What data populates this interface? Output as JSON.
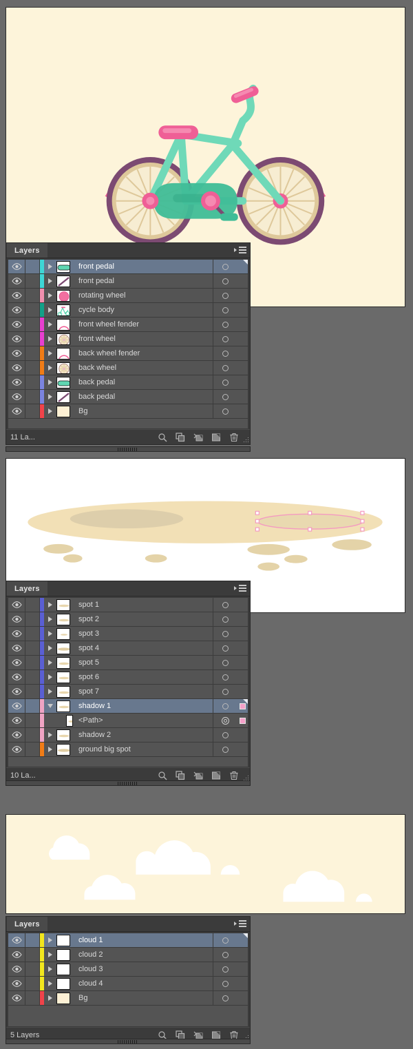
{
  "app": {
    "panel_title": "Layers",
    "menu_icon": "panel-flyout-menu-icon"
  },
  "colors": {
    "panel_bg": "#3b3b3b",
    "row_bg": "#545454",
    "row_selected": "#68788e",
    "canvas_cream": "#fdf4da",
    "canvas_white": "#ffffff",
    "workspace": "#6a6a6a",
    "selection_pink": "#f49ac1",
    "swatch_pink": "#f4a0c8"
  },
  "footer_icons": [
    {
      "name": "locate-object-icon",
      "label": "Locate Object"
    },
    {
      "name": "duplicate-layer-icon",
      "label": "Make/Release Clipping Mask"
    },
    {
      "name": "create-sublayer-icon",
      "label": "Create New Sublayer"
    },
    {
      "name": "new-layer-icon",
      "label": "Create New Layer"
    },
    {
      "name": "delete-layer-icon",
      "label": "Delete Selection"
    }
  ],
  "panels": [
    {
      "id": "bike",
      "title": "Layers",
      "count_label": "11 La...",
      "rows": [
        {
          "name": "front pedal",
          "color": "#3ed6d6",
          "selected": true,
          "expanded": false,
          "thumb": "pedal-green",
          "indent": 0,
          "target": "single",
          "swatch": null
        },
        {
          "name": "front pedal",
          "color": "#3ed6d6",
          "selected": false,
          "expanded": false,
          "thumb": "crank-diag",
          "indent": 0,
          "target": "single",
          "swatch": null
        },
        {
          "name": "rotating wheel",
          "color": "#f08fae",
          "selected": false,
          "expanded": false,
          "thumb": "hub-pink",
          "indent": 0,
          "target": "single",
          "swatch": null
        },
        {
          "name": "cycle body",
          "color": "#12a188",
          "selected": false,
          "expanded": false,
          "thumb": "frame-mini",
          "indent": 0,
          "target": "single",
          "swatch": null
        },
        {
          "name": "front wheel fender",
          "color": "#e83fd0",
          "selected": false,
          "expanded": false,
          "thumb": "fender-arc",
          "indent": 0,
          "target": "single",
          "swatch": null
        },
        {
          "name": "front wheel",
          "color": "#e83fd0",
          "selected": false,
          "expanded": false,
          "thumb": "wheel-spokes",
          "indent": 0,
          "target": "single",
          "swatch": null
        },
        {
          "name": "back wheel fender",
          "color": "#f07c16",
          "selected": false,
          "expanded": false,
          "thumb": "fender-arc",
          "indent": 0,
          "target": "single",
          "swatch": null
        },
        {
          "name": "back wheel",
          "color": "#f07c16",
          "selected": false,
          "expanded": false,
          "thumb": "wheel-spokes",
          "indent": 0,
          "target": "single",
          "swatch": null
        },
        {
          "name": "back pedal",
          "color": "#7b84e0",
          "selected": false,
          "expanded": false,
          "thumb": "pedal-green",
          "indent": 0,
          "target": "single",
          "swatch": null
        },
        {
          "name": "back pedal",
          "color": "#7b84e0",
          "selected": false,
          "expanded": false,
          "thumb": "crank-diag",
          "indent": 0,
          "target": "single",
          "swatch": null
        },
        {
          "name": "Bg",
          "color": "#f0434a",
          "selected": false,
          "expanded": false,
          "thumb": "cream-fill",
          "indent": 0,
          "target": "single",
          "swatch": null
        }
      ]
    },
    {
      "id": "ground",
      "title": "Layers",
      "count_label": "10 La...",
      "rows": [
        {
          "name": "spot 1",
          "color": "#5a5fd4",
          "selected": false,
          "expanded": false,
          "thumb": "spot-small",
          "indent": 0,
          "target": "single",
          "swatch": null
        },
        {
          "name": "spot 2",
          "color": "#5a5fd4",
          "selected": false,
          "expanded": false,
          "thumb": "spot-small",
          "indent": 0,
          "target": "single",
          "swatch": null
        },
        {
          "name": "spot 3",
          "color": "#5a5fd4",
          "selected": false,
          "expanded": false,
          "thumb": "spot-tiny",
          "indent": 0,
          "target": "single",
          "swatch": null
        },
        {
          "name": "spot 4",
          "color": "#5a5fd4",
          "selected": false,
          "expanded": false,
          "thumb": "spot-wide",
          "indent": 0,
          "target": "single",
          "swatch": null
        },
        {
          "name": "spot 5",
          "color": "#5a5fd4",
          "selected": false,
          "expanded": false,
          "thumb": "spot-small",
          "indent": 0,
          "target": "single",
          "swatch": null
        },
        {
          "name": "spot 6",
          "color": "#5a5fd4",
          "selected": false,
          "expanded": false,
          "thumb": "spot-small",
          "indent": 0,
          "target": "single",
          "swatch": null
        },
        {
          "name": "spot 7",
          "color": "#5a5fd4",
          "selected": false,
          "expanded": false,
          "thumb": "spot-small",
          "indent": 0,
          "target": "single",
          "swatch": null
        },
        {
          "name": "shadow 1",
          "color": "#f0a4c4",
          "selected": true,
          "expanded": true,
          "thumb": "spot-small",
          "indent": 0,
          "target": "single",
          "swatch": "#f4a0c8"
        },
        {
          "name": "<Path>",
          "color": "#f0a4c4",
          "selected": false,
          "expanded": null,
          "thumb": "spot-small",
          "indent": 1,
          "target": "double",
          "swatch": "#f4a0c8"
        },
        {
          "name": "shadow 2",
          "color": "#f0a4c4",
          "selected": false,
          "expanded": false,
          "thumb": "spot-small",
          "indent": 0,
          "target": "single",
          "swatch": null
        },
        {
          "name": "ground big spot",
          "color": "#f07c16",
          "selected": false,
          "expanded": false,
          "thumb": "spot-wide",
          "indent": 0,
          "target": "single",
          "swatch": null
        }
      ]
    },
    {
      "id": "clouds",
      "title": "Layers",
      "count_label": "5 Layers",
      "rows": [
        {
          "name": "cloud 1",
          "color": "#f2e71d",
          "selected": true,
          "expanded": false,
          "thumb": "white-fill",
          "indent": 0,
          "target": "single",
          "swatch": null
        },
        {
          "name": "cloud 2",
          "color": "#f2e71d",
          "selected": false,
          "expanded": false,
          "thumb": "white-fill",
          "indent": 0,
          "target": "single",
          "swatch": null
        },
        {
          "name": "cloud 3",
          "color": "#f2e71d",
          "selected": false,
          "expanded": false,
          "thumb": "white-fill",
          "indent": 0,
          "target": "single",
          "swatch": null
        },
        {
          "name": "cloud 4",
          "color": "#f2e71d",
          "selected": false,
          "expanded": false,
          "thumb": "white-fill",
          "indent": 0,
          "target": "single",
          "swatch": null
        },
        {
          "name": "Bg",
          "color": "#f0434a",
          "selected": false,
          "expanded": false,
          "thumb": "cream-fill",
          "indent": 0,
          "target": "single",
          "swatch": null
        }
      ]
    }
  ],
  "artwork": {
    "bike": {
      "name": "bicycle-illustration",
      "background": "#fdf4da",
      "palette": {
        "mint": "#6fd9b8",
        "mint_light": "#86e3c4",
        "mint_dark": "#3fbd97",
        "pink": "#ef5f96",
        "pink_light": "#f58ab1",
        "purple": "#7c4a72",
        "tan": "#dec89a",
        "cream": "#f7edd2"
      }
    },
    "ground": {
      "name": "ground-shadow-illustration",
      "background": "#ffffff",
      "palette": {
        "sand": "#f2e0b6",
        "sand_dark": "#ddceab",
        "spot": "#e4d3a8"
      },
      "selection_color": "#f49ac1"
    },
    "clouds": {
      "name": "clouds-illustration",
      "background": "#fdf4da",
      "palette": {
        "cloud": "#ffffff"
      }
    }
  }
}
